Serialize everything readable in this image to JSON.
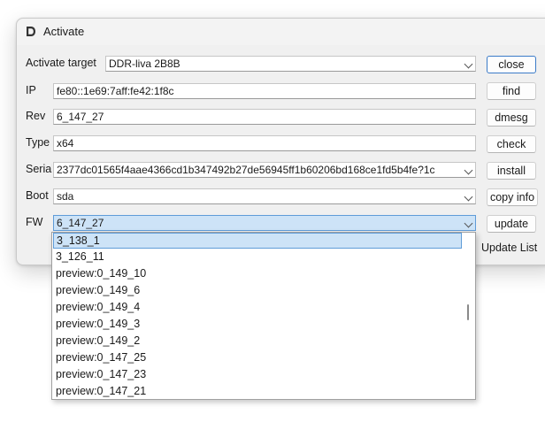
{
  "window": {
    "title": "Activate"
  },
  "form": {
    "target": {
      "label": "Activate target",
      "value": "DDR-liva 2B8B"
    },
    "ip": {
      "label": "IP",
      "value": "fe80::1e69:7aff:fe42:1f8c"
    },
    "rev": {
      "label": "Rev",
      "value": "6_147_27"
    },
    "type": {
      "label": "Type",
      "value": "x64"
    },
    "serial": {
      "label": "Serial",
      "value": "2377dc01565f4aae4366cd1b347492b27de56945ff1b60206bd168ce1fd5b4fe?1c"
    },
    "boot": {
      "label": "Boot",
      "value": "sda"
    },
    "fw": {
      "label": "FW",
      "value": "6_147_27"
    }
  },
  "buttons": {
    "close": "close",
    "find": "find",
    "dmesg": "dmesg",
    "check": "check",
    "install": "install",
    "copy_info": "copy info",
    "update": "update",
    "update_list": "Update List"
  },
  "fw_dropdown": {
    "items": [
      "3_138_1",
      "3_126_11",
      "preview:0_149_10",
      "preview:0_149_6",
      "preview:0_149_4",
      "preview:0_149_3",
      "preview:0_149_2",
      "preview:0_147_25",
      "preview:0_147_23",
      "preview:0_147_21"
    ],
    "selected_index": 0
  },
  "colors": {
    "accent": "#5f9cd8",
    "selection": "#cde3f7",
    "default_button_border": "#3b7bc8"
  }
}
